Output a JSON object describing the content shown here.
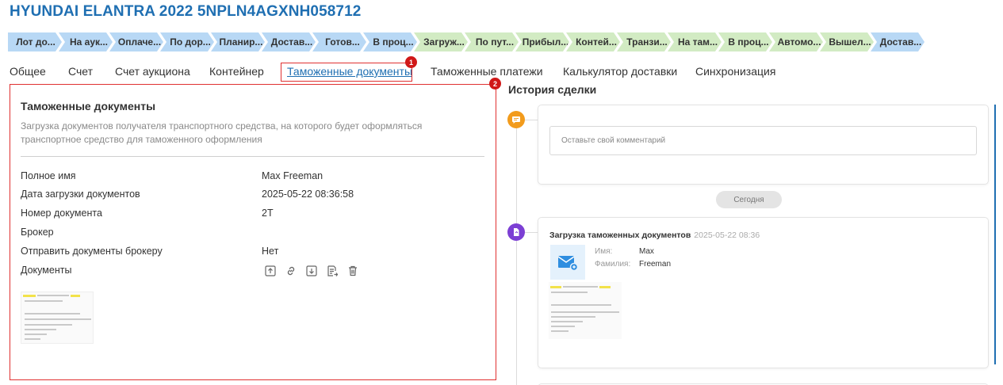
{
  "page": {
    "title": "HYUNDAI ELANTRA 2022 5NPLN4AGXNH058712"
  },
  "stages": [
    {
      "label": "Лот до...",
      "color": "blue"
    },
    {
      "label": "На аук...",
      "color": "blue"
    },
    {
      "label": "Оплаче...",
      "color": "blue"
    },
    {
      "label": "По дор...",
      "color": "blue"
    },
    {
      "label": "Планир...",
      "color": "blue"
    },
    {
      "label": "Достав...",
      "color": "blue"
    },
    {
      "label": "Готов...",
      "color": "blue"
    },
    {
      "label": "В проц...",
      "color": "blue"
    },
    {
      "label": "Загруж...",
      "color": "green"
    },
    {
      "label": "По пут...",
      "color": "green"
    },
    {
      "label": "Прибыл...",
      "color": "green"
    },
    {
      "label": "Контей...",
      "color": "green"
    },
    {
      "label": "Транзи...",
      "color": "green"
    },
    {
      "label": "На там...",
      "color": "green"
    },
    {
      "label": "В проц...",
      "color": "green"
    },
    {
      "label": "Автомо...",
      "color": "green"
    },
    {
      "label": "Вышел...",
      "color": "green"
    },
    {
      "label": "Достав...",
      "color": "blue"
    }
  ],
  "tabs": {
    "general": "Общее",
    "invoice": "Счет",
    "auction_invoice": "Счет аукциона",
    "container": "Контейнер",
    "customs_docs": "Таможенные документы",
    "customs_payments": "Таможенные платежи",
    "delivery_calc": "Калькулятор доставки",
    "sync": "Синхронизация"
  },
  "badges": {
    "one": "1",
    "two": "2"
  },
  "customs_docs": {
    "title": "Таможенные документы",
    "description": "Загрузка документов получателя транспортного средства, на которого будет оформляться транспортное средство для таможенного оформления",
    "fields": {
      "full_name_label": "Полное имя",
      "full_name_value": "Max Freeman",
      "upload_date_label": "Дата загрузки документов",
      "upload_date_value": "2025-05-22 08:36:58",
      "doc_number_label": "Номер документа",
      "doc_number_value": "2T",
      "broker_label": "Брокер",
      "broker_value": "",
      "send_to_broker_label": "Отправить документы брокеру",
      "send_to_broker_value": "Нет",
      "documents_label": "Документы"
    }
  },
  "history": {
    "title": "История сделки",
    "comment_placeholder": "Оставьте свой комментарий",
    "today_label": "Сегодня",
    "event": {
      "title": "Загрузка таможенных документов",
      "time": "2025-05-22 08:36",
      "first_name_label": "Имя:",
      "first_name_value": "Max",
      "last_name_label": "Фамилия:",
      "last_name_value": "Freeman"
    }
  },
  "colors": {
    "accent": "#1f6fb2",
    "stage_blue": "#b8d8f5",
    "stage_green": "#d2ebc3",
    "highlight_red": "#e03030",
    "comment_icon": "#f29b1c",
    "doc_icon": "#7c3fd4"
  },
  "icons": {
    "actions": [
      "upload-icon",
      "link-icon",
      "download-icon",
      "send-document-icon",
      "trash-icon"
    ],
    "history": [
      "comment-icon",
      "document-icon",
      "mail-icon"
    ]
  }
}
